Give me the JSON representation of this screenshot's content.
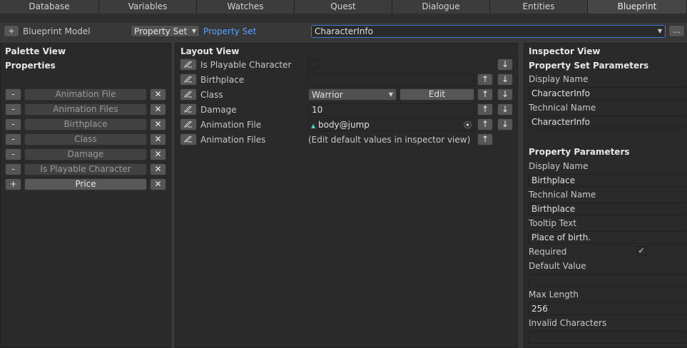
{
  "tabs": [
    "Database",
    "Variables",
    "Watches",
    "Quest",
    "Dialogue",
    "Entities",
    "Blueprint"
  ],
  "active_tab": "Blueprint",
  "toolbar": {
    "add_label": "+",
    "model_label": "Blueprint Model",
    "type_select": "Property Set",
    "type_link": "Property Set",
    "set_select": "CharacterInfo",
    "more_label": "..."
  },
  "palette": {
    "title": "Palette View",
    "subtitle": "Properties",
    "items": [
      {
        "action": "-",
        "name": "Animation File",
        "remove": "✕"
      },
      {
        "action": "-",
        "name": "Animation Files",
        "remove": "✕"
      },
      {
        "action": "-",
        "name": "Birthplace",
        "remove": "✕"
      },
      {
        "action": "-",
        "name": "Class",
        "remove": "✕"
      },
      {
        "action": "-",
        "name": "Damage",
        "remove": "✕"
      },
      {
        "action": "-",
        "name": "Is Playable Character",
        "remove": "✕"
      },
      {
        "action": "+",
        "name": "Price",
        "remove": "✕"
      }
    ]
  },
  "layout": {
    "title": "Layout View",
    "rows": [
      {
        "label": "Is Playable Character"
      },
      {
        "label": "Birthplace",
        "value": ""
      },
      {
        "label": "Class",
        "value": "Warrior",
        "edit": "Edit"
      },
      {
        "label": "Damage",
        "value": "10"
      },
      {
        "label": "Animation File",
        "value": "body@jump"
      },
      {
        "label": "Animation Files",
        "value": "(Edit default values in inspector view)"
      }
    ],
    "up": "↑",
    "down": "↓"
  },
  "inspector": {
    "title": "Inspector View",
    "set_section": "Property Set Parameters",
    "set_display_label": "Display Name",
    "set_display_value": "CharacterInfo",
    "set_tech_label": "Technical Name",
    "set_tech_value": "CharacterInfo",
    "prop_section": "Property Parameters",
    "prop_display_label": "Display Name",
    "prop_display_value": "Birthplace",
    "prop_tech_label": "Technical Name",
    "prop_tech_value": "Birthplace",
    "tooltip_label": "Tooltip Text",
    "tooltip_value": "Place of birth.",
    "required_label": "Required",
    "required_check": "✓",
    "default_label": "Default Value",
    "default_value": "",
    "maxlen_label": "Max Length",
    "maxlen_value": "256",
    "invalid_label": "Invalid Characters",
    "invalid_value": ""
  }
}
